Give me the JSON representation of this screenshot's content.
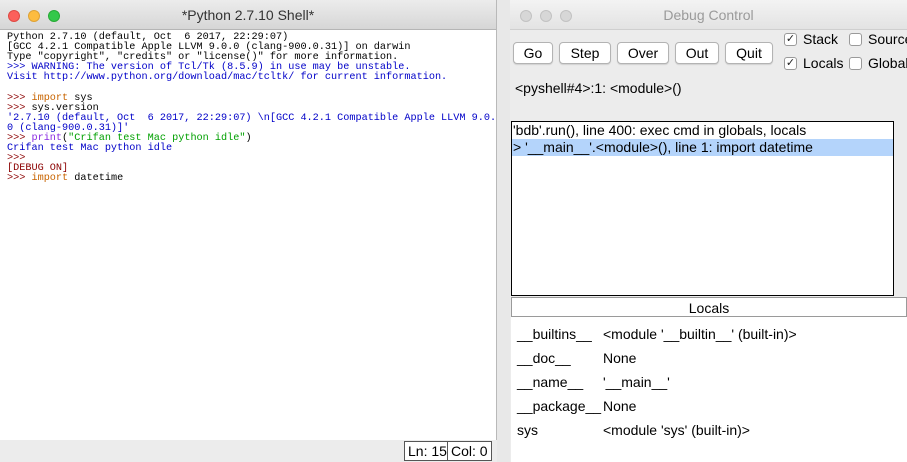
{
  "shell": {
    "title": "*Python 2.7.10 Shell*",
    "lines": [
      [
        {
          "t": "Python 2.7.10 (default, Oct  6 2017, 22:29:07)",
          "c": "black"
        }
      ],
      [
        {
          "t": "[GCC 4.2.1 Compatible Apple LLVM 9.0.0 (clang-900.0.31)] on darwin",
          "c": "black"
        }
      ],
      [
        {
          "t": "Type \"copyright\", \"credits\" or \"license()\" for more information.",
          "c": "black"
        }
      ],
      [
        {
          "t": ">>> WARNING: The version of Tcl/Tk (8.5.9) in use may be unstable.",
          "c": "blue"
        }
      ],
      [
        {
          "t": "Visit http://www.python.org/download/mac/tcltk/ for current information.",
          "c": "blue"
        }
      ],
      [
        {
          "t": "",
          "c": "black"
        }
      ],
      [
        {
          "t": ">>> ",
          "c": "maroon"
        },
        {
          "t": "import",
          "c": "orange"
        },
        {
          "t": " sys",
          "c": "black"
        }
      ],
      [
        {
          "t": ">>> ",
          "c": "maroon"
        },
        {
          "t": "sys.version",
          "c": "black"
        }
      ],
      [
        {
          "t": "'2.7.10 (default, Oct  6 2017, 22:29:07) \\n[GCC 4.2.1 Compatible Apple LLVM 9.0.",
          "c": "blue"
        }
      ],
      [
        {
          "t": "0 (clang-900.0.31)]'",
          "c": "blue"
        }
      ],
      [
        {
          "t": ">>> ",
          "c": "maroon"
        },
        {
          "t": "print",
          "c": "purple"
        },
        {
          "t": "(",
          "c": "black"
        },
        {
          "t": "\"Crifan test Mac python idle\"",
          "c": "green"
        },
        {
          "t": ")",
          "c": "black"
        }
      ],
      [
        {
          "t": "Crifan test Mac python idle",
          "c": "blue"
        }
      ],
      [
        {
          "t": ">>> ",
          "c": "maroon"
        }
      ],
      [
        {
          "t": "[DEBUG ON]",
          "c": "maroon"
        }
      ],
      [
        {
          "t": ">>> ",
          "c": "maroon"
        },
        {
          "t": "import",
          "c": "orange"
        },
        {
          "t": " datetime",
          "c": "black"
        }
      ]
    ],
    "status": {
      "line": "Ln: 15",
      "col": "Col: 0"
    }
  },
  "debug": {
    "title": "Debug Control",
    "buttons": {
      "go": "Go",
      "step": "Step",
      "over": "Over",
      "out": "Out",
      "quit": "Quit"
    },
    "checkboxes": {
      "stack": {
        "label": "Stack",
        "checked": true
      },
      "source": {
        "label": "Source",
        "checked": false
      },
      "locals": {
        "label": "Locals",
        "checked": true
      },
      "globals": {
        "label": "Globals",
        "checked": false
      }
    },
    "location": "<pyshell#4>:1: <module>()",
    "stack": [
      {
        "text": "'bdb'.run(), line 400: exec cmd in globals, locals",
        "selected": false
      },
      {
        "text": "> '__main__'.<module>(), line 1: import datetime",
        "selected": true
      }
    ],
    "locals_header": "Locals",
    "locals": [
      {
        "name": "__builtins__",
        "value": "<module '__builtin__' (built-in)>"
      },
      {
        "name": "__doc__",
        "value": "None"
      },
      {
        "name": "__name__",
        "value": "'__main__'"
      },
      {
        "name": "__package__",
        "value": "None"
      },
      {
        "name": "sys",
        "value": "<module 'sys' (built-in)>"
      }
    ],
    "check_glyph": "✓"
  }
}
